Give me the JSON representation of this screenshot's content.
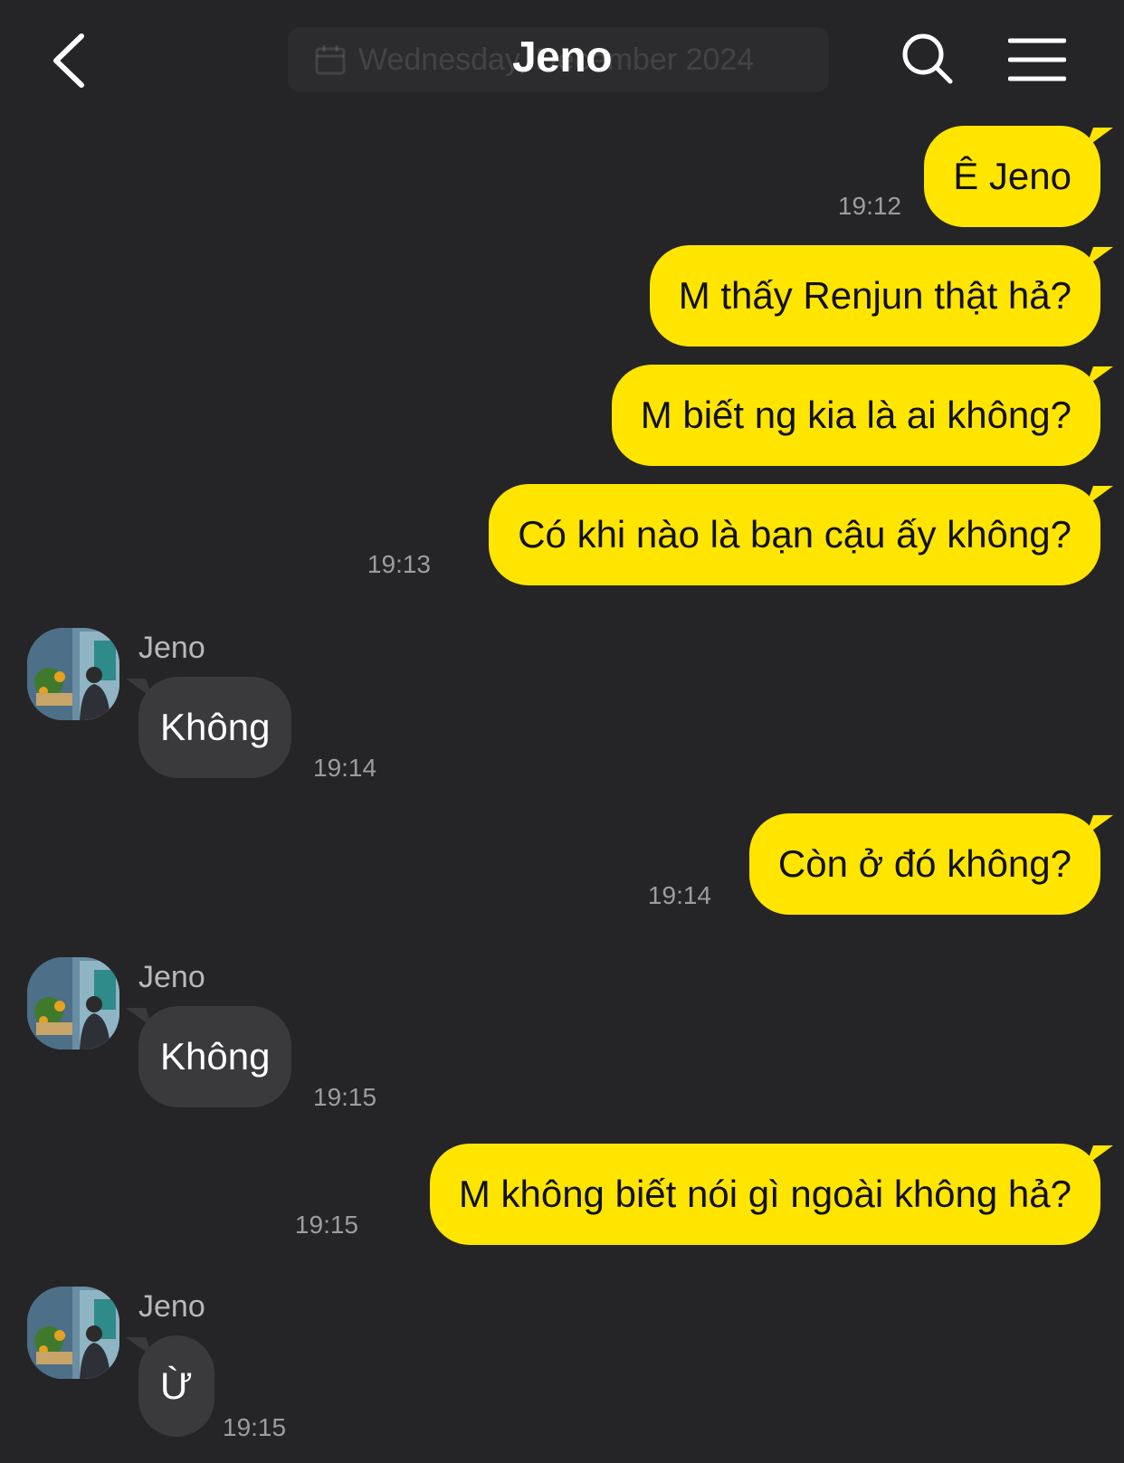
{
  "header": {
    "title": "Jeno",
    "date_label": "Wednesday, December 2024",
    "back_icon": "chevron-left-icon",
    "search_icon": "search-icon",
    "menu_icon": "hamburger-menu-icon"
  },
  "colors": {
    "background": "#252527",
    "outgoing_bubble": "#ffe500",
    "incoming_bubble": "#3a3a3c"
  },
  "messages": [
    {
      "direction": "out",
      "text": "Ê Jeno",
      "time": "19:12"
    },
    {
      "direction": "out",
      "text": "M thấy Renjun thật hả?",
      "time": ""
    },
    {
      "direction": "out",
      "text": "M biết ng kia là ai không?",
      "time": ""
    },
    {
      "direction": "out",
      "text": "Có khi nào là bạn cậu ấy không?",
      "time": "19:13"
    },
    {
      "direction": "in",
      "sender": "Jeno",
      "text": "Không",
      "time": "19:14"
    },
    {
      "direction": "out",
      "text": "Còn ở đó không?",
      "time": "19:14"
    },
    {
      "direction": "in",
      "sender": "Jeno",
      "text": "Không",
      "time": "19:15"
    },
    {
      "direction": "out",
      "text": "M không biết nói gì ngoài không hả?",
      "time": "19:15"
    },
    {
      "direction": "in",
      "sender": "Jeno",
      "text": "Ừ",
      "time": "19:15"
    }
  ]
}
